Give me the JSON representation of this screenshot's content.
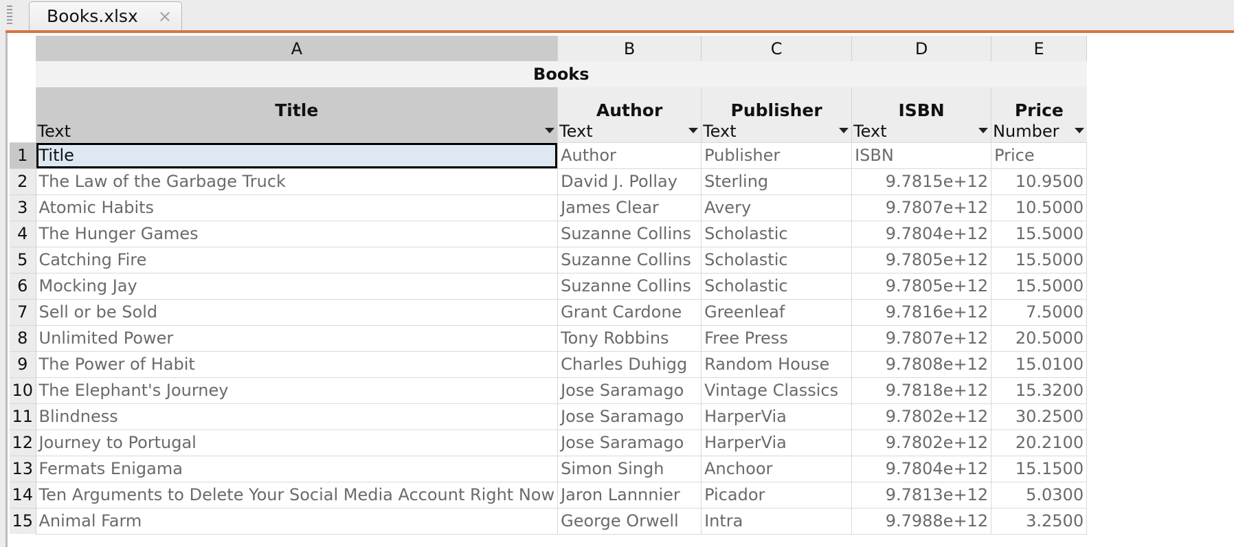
{
  "tab": {
    "title": "Books.xlsx"
  },
  "table": {
    "name": "Books",
    "columns": [
      {
        "letter": "A",
        "field": "Title",
        "type": "Text"
      },
      {
        "letter": "B",
        "field": "Author",
        "type": "Text"
      },
      {
        "letter": "C",
        "field": "Publisher",
        "type": "Text"
      },
      {
        "letter": "D",
        "field": "ISBN",
        "type": "Text"
      },
      {
        "letter": "E",
        "field": "Price",
        "type": "Number"
      }
    ],
    "rows": [
      [
        "1",
        "Title",
        "Author",
        "Publisher",
        "ISBN",
        "Price"
      ],
      [
        "2",
        "The Law of the Garbage Truck",
        "David J. Pollay",
        "Sterling",
        "9.7815e+12",
        "10.9500"
      ],
      [
        "3",
        "Atomic Habits",
        "James Clear",
        "Avery",
        "9.7807e+12",
        "10.5000"
      ],
      [
        "4",
        "The Hunger Games",
        "Suzanne Collins",
        "Scholastic",
        "9.7804e+12",
        "15.5000"
      ],
      [
        "5",
        "Catching Fire",
        "Suzanne Collins",
        "Scholastic",
        "9.7805e+12",
        "15.5000"
      ],
      [
        "6",
        "Mocking Jay",
        "Suzanne Collins",
        "Scholastic",
        "9.7805e+12",
        "15.5000"
      ],
      [
        "7",
        "Sell or be Sold",
        "Grant Cardone",
        "Greenleaf",
        "9.7816e+12",
        "7.5000"
      ],
      [
        "8",
        "Unlimited Power",
        "Tony Robbins",
        "Free Press",
        "9.7807e+12",
        "20.5000"
      ],
      [
        "9",
        "The Power of Habit",
        "Charles Duhigg",
        "Random House",
        "9.7808e+12",
        "15.0100"
      ],
      [
        "10",
        "The Elephant's Journey",
        "Jose Saramago",
        "Vintage Classics",
        "9.7818e+12",
        "15.3200"
      ],
      [
        "11",
        "Blindness",
        "Jose Saramago",
        "HarperVia",
        "9.7802e+12",
        "30.2500"
      ],
      [
        "12",
        "Journey to Portugal",
        "Jose Saramago",
        "HarperVia",
        "9.7802e+12",
        "20.2100"
      ],
      [
        "13",
        "Fermats Enigama",
        "Simon Singh",
        "Anchoor",
        "9.7804e+12",
        "15.1500"
      ],
      [
        "14",
        "Ten Arguments to Delete Your Social Media Account Right Now",
        "Jaron Lannnier",
        "Picador",
        "9.7813e+12",
        "5.0300"
      ],
      [
        "15",
        "Animal Farm",
        "George Orwell",
        "Intra",
        "9.7988e+12",
        "3.2500"
      ]
    ]
  }
}
